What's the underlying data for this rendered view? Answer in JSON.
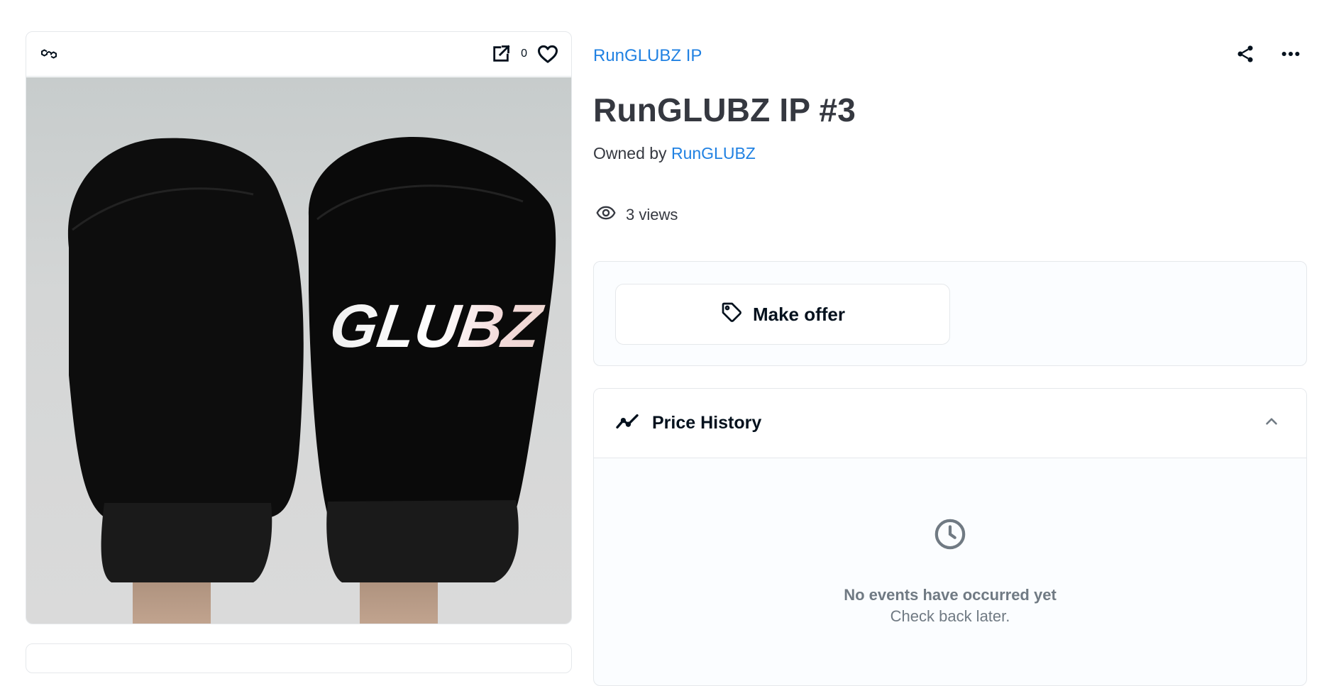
{
  "media": {
    "like_count": "0",
    "image_wordmark": "GLUBZ"
  },
  "header": {
    "collection_name": "RunGLUBZ IP",
    "asset_title": "RunGLUBZ IP #3",
    "owned_by_prefix": "Owned by",
    "owner_name": "RunGLUBZ"
  },
  "stats": {
    "views": "3 views"
  },
  "offer": {
    "button_label": "Make offer"
  },
  "price_history": {
    "title": "Price History",
    "empty_title": "No events have occurred yet",
    "empty_subtitle": "Check back later."
  },
  "colors": {
    "link": "#2081e2",
    "text": "#353840",
    "muted": "#707a83",
    "border": "#e5e8eb"
  },
  "icons": [
    "polygon-chain-icon",
    "open-external-icon",
    "heart-icon",
    "share-icon",
    "more-icon",
    "eye-icon",
    "tag-icon",
    "trending-icon",
    "chevron-up-icon",
    "clock-icon"
  ]
}
